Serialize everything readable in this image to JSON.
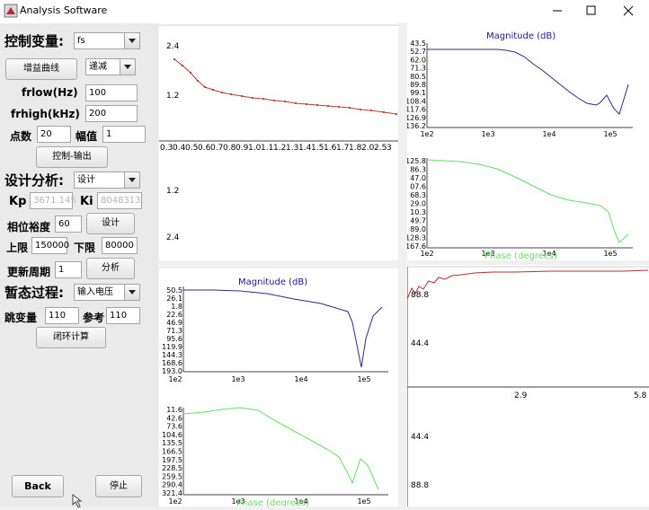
{
  "window": {
    "title": "Analysis Software"
  },
  "left": {
    "control_var_label": "控制变量:",
    "control_var_value": "fs",
    "gain_curve_button": "增益曲线",
    "direction_value": "递减",
    "frlow_label": "frlow(Hz)",
    "frlow_value": "100",
    "frhigh_label": "frhigh(kHz)",
    "frhigh_value": "200",
    "points_label": "点数",
    "points_value": "20",
    "amplitude_label": "幅值",
    "amplitude_value": "1",
    "control_output_button": "控制-输出",
    "design_label": "设计分析:",
    "design_value": "设计",
    "kp_label": "Kp",
    "kp_value": "3671.145",
    "ki_label": "Ki",
    "ki_value": "8048313.",
    "phase_margin_label": "相位裕度",
    "phase_margin_value": "60",
    "design_button": "设计",
    "upper_label": "上限",
    "upper_value": "150000",
    "lower_label": "下限",
    "lower_value": "80000",
    "update_period_label": "更新周期",
    "update_period_value": "1",
    "analysis_button": "分析",
    "transient_label": "暂态过程:",
    "transient_value": "输入电压",
    "jump_label": "跳变量",
    "jump_value": "110",
    "ref_label": "参考",
    "ref_value": "110",
    "closed_loop_button": "闭环计算",
    "back_button": "Back",
    "stop_button": "停止"
  },
  "plots": {
    "gain_curve": {
      "y_ticks_top": [
        "2.4",
        "1.2"
      ],
      "x_ticks": [
        "0.3",
        "0.4",
        "0.5",
        "0.6",
        "0.7",
        "0.8",
        "0.9",
        "1.0",
        "1.1",
        "1.2",
        "1.3",
        "1.4",
        "1.5",
        "1.6",
        "1.7",
        "1.8",
        "2.0",
        "2.5",
        "3"
      ],
      "y_ticks_bottom": [
        "1.2",
        "2.4"
      ],
      "color": "#c0392b"
    },
    "bode_right": {
      "mag_title": "Magnitude (dB)",
      "mag_y": [
        "43.5",
        "52.7",
        "62.0",
        "71.3",
        "80.5",
        "89.8",
        "99.1",
        "108.4",
        "117.6",
        "126.9",
        "136.2"
      ],
      "phase_title": "Phase (degrees)",
      "phase_y": [
        "125.8",
        "86.3",
        "47.0",
        "07.6",
        "68.3",
        "29.0",
        "10.3",
        "49.7",
        "89.0",
        "128.3",
        "167.6"
      ],
      "x": [
        "1e2",
        "1e3",
        "1e4",
        "1e5"
      ]
    },
    "bode_left": {
      "mag_title": "Magnitude (dB)",
      "mag_y": [
        "50.5",
        "26.1",
        "1.8",
        "22.6",
        "46.9",
        "71.3",
        "95.6",
        "119.9",
        "144.3",
        "168.6",
        "193.0"
      ],
      "phase_title": "Phase (degrees)",
      "phase_y": [
        "11.6",
        "42.6",
        "73.6",
        "104.6",
        "135.5",
        "166.5",
        "197.5",
        "228.5",
        "259.5",
        "290.4",
        "321.4"
      ],
      "x": [
        "1e2",
        "1e3",
        "1e4",
        "1e5"
      ]
    },
    "transient": {
      "y_top": [
        "88.8",
        "44.4"
      ],
      "x": [
        "2.9",
        "5.8"
      ],
      "y_bottom": [
        "44.4",
        "88.8"
      ]
    }
  },
  "colors": {
    "magnitude": "#2b2b8c",
    "phase": "#66dd66",
    "transient": "#b03030",
    "title": "#1a1a8c"
  }
}
